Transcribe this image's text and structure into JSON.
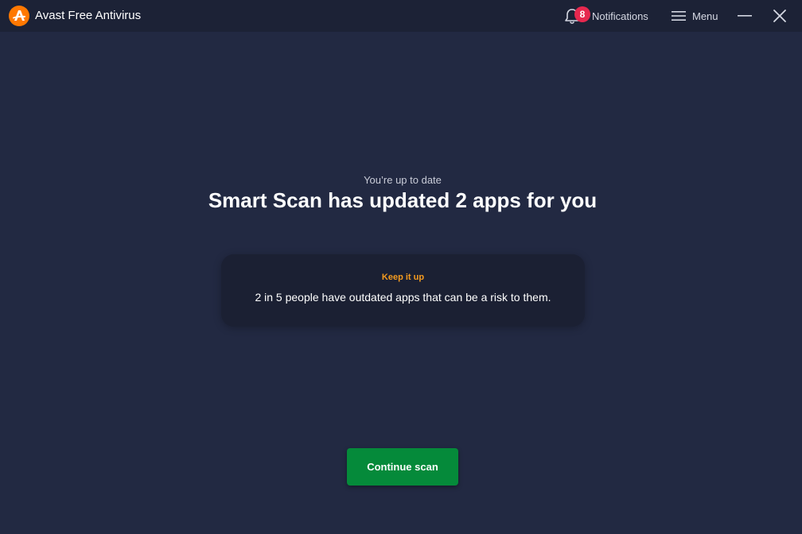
{
  "app": {
    "title": "Avast Free Antivirus",
    "brand_color": "#ff7800"
  },
  "header": {
    "notifications": {
      "label": "Notifications",
      "count": "8",
      "icon": "bell-icon",
      "badge_color": "#e6284f"
    },
    "menu": {
      "label": "Menu",
      "icon": "hamburger-icon"
    },
    "window_controls": {
      "minimize_icon": "minimize-icon",
      "close_icon": "close-icon"
    }
  },
  "main": {
    "subtitle": "You’re up to date",
    "headline": "Smart Scan has updated 2 apps for you",
    "tip": {
      "title": "Keep it up",
      "title_color": "#f59b1f",
      "text": "2 in 5 people have outdated apps that can be a risk to them."
    },
    "continue_button": {
      "label": "Continue scan",
      "color": "#058a3a"
    }
  }
}
